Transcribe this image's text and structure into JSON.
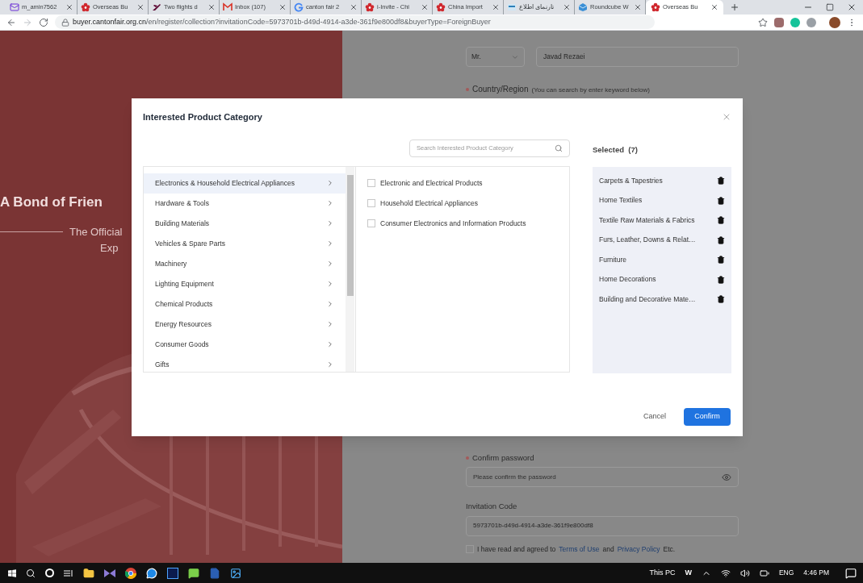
{
  "browser": {
    "tabs": [
      {
        "kind": "mail",
        "title": "m_amin7562",
        "selected": false
      },
      {
        "kind": "flower",
        "title": "Overseas Bu",
        "selected": false
      },
      {
        "kind": "plane",
        "title": "Two flights d",
        "selected": false
      },
      {
        "kind": "gmail",
        "title": "Inbox (107)",
        "selected": false
      },
      {
        "kind": "google",
        "title": "canton fair 2",
        "selected": false
      },
      {
        "kind": "flower",
        "title": "i-Invite - Chi",
        "selected": false
      },
      {
        "kind": "flower",
        "title": "China Import",
        "selected": false
      },
      {
        "kind": "site",
        "title": "تارنمای اطلاع",
        "selected": false
      },
      {
        "kind": "cube",
        "title": "Roundcube W",
        "selected": false
      },
      {
        "kind": "flower",
        "title": "Overseas Bu",
        "selected": true
      }
    ],
    "url_host": "buyer.cantonfair.org.cn",
    "url_path": "/en/register/collection?invitationCode=5973701b-d49d-4914-a3de-361f9e800df8&buyerType=ForeignBuyer"
  },
  "hero": {
    "headline": "A Bond of Frien",
    "subline_1": "The Official",
    "subline_2": "Exp"
  },
  "form": {
    "salutation": "Mr.",
    "name_value": "Javad Rezaei",
    "country_label": "Country/Region",
    "country_hint": "(You can search by enter keyword below)",
    "country_required": true,
    "confirm_label": "Confirm password",
    "confirm_required": true,
    "confirm_placeholder": "Please confirm the password",
    "invitation_label": "Invitation Code",
    "invitation_value": "5973701b-d49d-4914-a3de-361f9e800df8",
    "agree_checked": false,
    "agree_text": "I have read and agreed to",
    "terms_link": "Terms of Use",
    "and_text": "and",
    "privacy_link": "Privacy Policy",
    "etc_text": "Etc."
  },
  "modal": {
    "title": "Interested Product Category",
    "search_placeholder": "Search Interested Product Category",
    "selected_heading": "Selected  (7)",
    "categories": [
      {
        "label": "Electronics & Household Electrical Appliances",
        "selected": true
      },
      {
        "label": "Hardware & Tools",
        "selected": false
      },
      {
        "label": "Building Materials",
        "selected": false
      },
      {
        "label": "Vehicles & Spare Parts",
        "selected": false
      },
      {
        "label": "Machinery",
        "selected": false
      },
      {
        "label": "Lighting Equipment",
        "selected": false
      },
      {
        "label": "Chemical Products",
        "selected": false
      },
      {
        "label": "Energy Resources",
        "selected": false
      },
      {
        "label": "Consumer Goods",
        "selected": false
      },
      {
        "label": "Gifts",
        "selected": false
      }
    ],
    "subcategories": [
      {
        "label": "Electronic and Electrical Products",
        "checked": false
      },
      {
        "label": "Household Electrical Appliances",
        "checked": false
      },
      {
        "label": "Consumer Electronics and Information Products",
        "checked": false
      }
    ],
    "selected_items": [
      "Carpets & Tapestries",
      "Home Textiles",
      "Textile Raw Materials & Fabrics",
      "Furs, Leather, Downs & Relat…",
      "Furniture",
      "Home Decorations",
      "Building and Decorative Mate…"
    ],
    "cancel": "Cancel",
    "confirm": "Confirm"
  },
  "taskbar": {
    "this_pc": "This PC",
    "w": "W",
    "lang": "ENG",
    "time": "4:46 PM"
  }
}
